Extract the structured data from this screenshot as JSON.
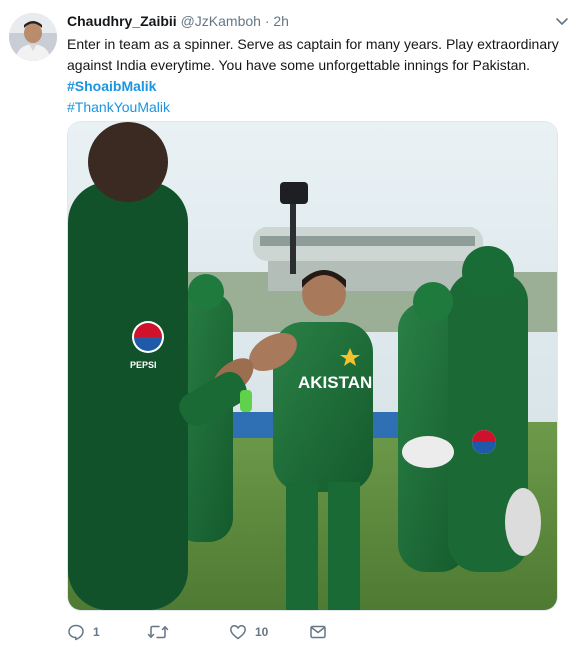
{
  "author": {
    "display_name": "Chaudhry_Zaibii",
    "handle": "@JzKamboh",
    "separator": "·",
    "time": "2h"
  },
  "tweet": {
    "text_lines": [
      "Enter in team as a spinner. Serve as captain for many years. Play extraordinary",
      "against India everytime. You have some unforgettable innings for Pakistan."
    ],
    "hashtags": [
      "#ShoaibMalik",
      "#ThankYouMalik"
    ]
  },
  "media": {
    "jersey_text": "AKISTAN",
    "sponsor_text": "PEPSI"
  },
  "actions": {
    "reply_count": "1",
    "retweet_count": "",
    "like_count": "10"
  },
  "icons": {
    "caret": "chevron-down-icon",
    "reply": "reply-icon",
    "retweet": "retweet-icon",
    "like": "heart-icon",
    "message": "envelope-icon"
  },
  "colors": {
    "link": "#1b95e0",
    "muted": "#657786",
    "jersey": "#1f6e3a"
  }
}
